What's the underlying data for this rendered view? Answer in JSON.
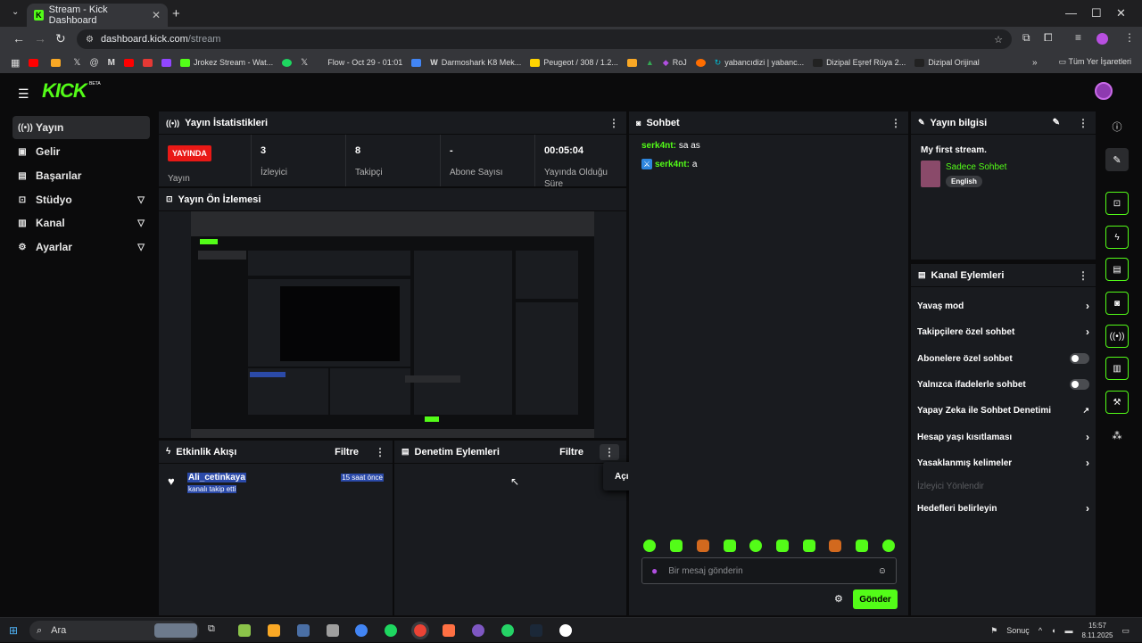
{
  "browser": {
    "tab_title": "Stream - Kick Dashboard",
    "url_host": "dashboard.kick.com",
    "url_path": "/stream",
    "bookmarks": [
      {
        "label": "",
        "color": "#ff0000"
      },
      {
        "label": "",
        "color": "#f9a825"
      },
      {
        "label": "",
        "color": "#ffffff"
      },
      {
        "label": "",
        "color": "#ffffff"
      },
      {
        "label": "",
        "color": "#ffffff"
      },
      {
        "label": "",
        "color": "#ff0000"
      },
      {
        "label": "",
        "color": "#e53935"
      },
      {
        "label": "",
        "color": "#9146ff"
      },
      {
        "label": "Jrokez Stream - Wat...",
        "color": "#53fc18"
      },
      {
        "label": "",
        "color": "#1ed760"
      },
      {
        "label": "",
        "color": "#ffffff"
      },
      {
        "label": "Flow - Oct 29 - 01:01",
        "color": "#222222"
      },
      {
        "label": "",
        "color": "#4285f4"
      },
      {
        "label": "Darmoshark K8 Mek...",
        "color": "#ffffff"
      },
      {
        "label": "Peugeot / 308 / 1.2...",
        "color": "#ffd400"
      },
      {
        "label": "",
        "color": "#f9a825"
      },
      {
        "label": "",
        "color": "#34a853"
      },
      {
        "label": "RoJ",
        "color": "#7b1fa2"
      },
      {
        "label": "",
        "color": "#ff6d00"
      },
      {
        "label": "yabancıdizi | yabanc...",
        "color": "#00bcd4"
      },
      {
        "label": "Dizipal Eşref Rüya 2...",
        "color": "#222222"
      },
      {
        "label": "Dizipal Orijinal",
        "color": "#222222"
      }
    ],
    "all_bookmarks": "Tüm Yer İşaretleri"
  },
  "header": {
    "logo": "KICK",
    "beta": "BETA"
  },
  "sidebar": {
    "items": [
      {
        "label": "Yayın",
        "icon": "broadcast-icon",
        "active": true
      },
      {
        "label": "Gelir",
        "icon": "revenue-icon"
      },
      {
        "label": "Başarılar",
        "icon": "trophy-icon"
      },
      {
        "label": "Stüdyo",
        "icon": "studio-icon",
        "expandable": true
      },
      {
        "label": "Kanal",
        "icon": "channel-icon",
        "expandable": true
      },
      {
        "label": "Ayarlar",
        "icon": "gear-icon",
        "expandable": true
      }
    ]
  },
  "stats_panel": {
    "title": "Yayın İstatistikleri",
    "live_badge": "YAYINDA",
    "items": [
      {
        "value": "",
        "label": "Yayın"
      },
      {
        "value": "3",
        "label": "İzleyici"
      },
      {
        "value": "8",
        "label": "Takipçi"
      },
      {
        "value": "-",
        "label": "Abone Sayısı"
      },
      {
        "value": "00:05:04",
        "label": "Yayında Olduğu Süre"
      }
    ]
  },
  "preview_panel": {
    "title": "Yayın Ön İzlemesi"
  },
  "activity_panel": {
    "title": "Etkinlik Akışı",
    "filter": "Filtre",
    "events": [
      {
        "user": "Ali_cetinkaya",
        "action": "kanalı takip etti",
        "time": "15 saat önce"
      }
    ]
  },
  "moderation_panel": {
    "title": "Denetim Eylemleri",
    "filter": "Filtre",
    "tooltip": "Açılır Pencerede Denetim Eylemleri"
  },
  "chat_panel": {
    "title": "Sohbet",
    "messages": [
      {
        "user": "serk4nt:",
        "text": "sa as",
        "badge": false
      },
      {
        "user": "serk4nt:",
        "text": "a",
        "badge": true
      }
    ],
    "emote_colors": [
      "#53fc18",
      "#53fc18",
      "#d2691e",
      "#53fc18",
      "#53fc18",
      "#53fc18",
      "#53fc18",
      "#d2691e",
      "#53fc18",
      "#53fc18"
    ],
    "input_placeholder": "Bir mesaj gönderin",
    "send_label": "Gönder"
  },
  "stream_info": {
    "title": "Yayın bilgisi",
    "stream_title": "My first stream.",
    "category": "Sadece Sohbet",
    "language": "English"
  },
  "channel_actions": {
    "title": "Kanal Eylemleri",
    "items": [
      {
        "label": "Yavaş mod",
        "control": "chevron"
      },
      {
        "label": "Takipçilere özel sohbet",
        "control": "chevron"
      },
      {
        "label": "Abonelere özel sohbet",
        "control": "toggle"
      },
      {
        "label": "Yalnızca ifadelerle sohbet",
        "control": "toggle"
      },
      {
        "label": "Yapay Zeka ile Sohbet Denetimi",
        "control": "external"
      },
      {
        "label": "Hesap yaşı kısıtlaması",
        "control": "chevron"
      },
      {
        "label": "Yasaklanmış kelimeler",
        "control": "chevron"
      },
      {
        "label": "İzleyici Yönlendir",
        "control": "disabled"
      },
      {
        "label": "Hedefleri belirleyin",
        "control": "chevron"
      }
    ]
  },
  "taskbar": {
    "search": "Ara",
    "weather": "Sonuç",
    "time": "15:57",
    "date": "8.11.2025"
  }
}
